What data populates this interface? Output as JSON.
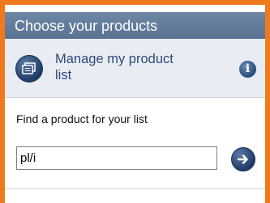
{
  "header": {
    "title": "Choose your products"
  },
  "manage": {
    "link_label": "Manage my product list",
    "icon": "manage-list-icon",
    "info_icon": "info-icon",
    "info_glyph": "i"
  },
  "finder": {
    "label": "Find a product for your list",
    "search_value": "pl/i",
    "go_icon": "arrow-right-icon"
  },
  "colors": {
    "frame_border": "#ef7a1e",
    "header_bg": "#6a82a2",
    "manage_row_bg": "#e9edf3",
    "link_text": "#2b4a78",
    "icon_bg": "#1f3c66"
  }
}
